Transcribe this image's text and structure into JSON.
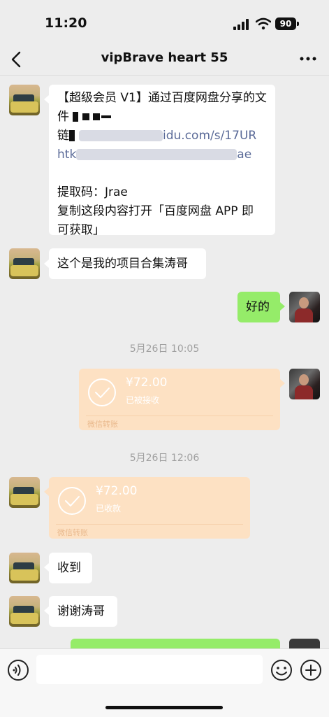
{
  "status_bar": {
    "time": "11:20",
    "battery": "90"
  },
  "nav": {
    "title": "vipBrave heart 55"
  },
  "messages": {
    "share": {
      "line1": "【超级会员 V1】通过百度网盘分享的文",
      "line2": "件",
      "line3_prefix": "链",
      "line3_visible": "idu.com/s/17UR",
      "line4_prefix": "htk",
      "line4_suffix": "ae",
      "line6": "提取码：Jrae",
      "line7": "复制这段内容打开「百度网盘 APP 即",
      "line8": "可获取」"
    },
    "collection": "这个是我的项目合集涛哥",
    "ok": "好的",
    "thanks_received": "收到",
    "thanks": "谢谢涛哥"
  },
  "timestamps": {
    "t1": "5月26日 10:05",
    "t2": "5月26日 12:06"
  },
  "transfers": {
    "sent": {
      "amount": "¥72.00",
      "status": "已被接收",
      "footer": "微信转账"
    },
    "received": {
      "amount": "¥72.00",
      "status": "已收款",
      "footer": "微信转账"
    }
  },
  "input": {
    "placeholder": ""
  },
  "colors": {
    "bubble_green": "#95ec69",
    "transfer_bg": "#fde1c3",
    "background": "#ededed"
  }
}
